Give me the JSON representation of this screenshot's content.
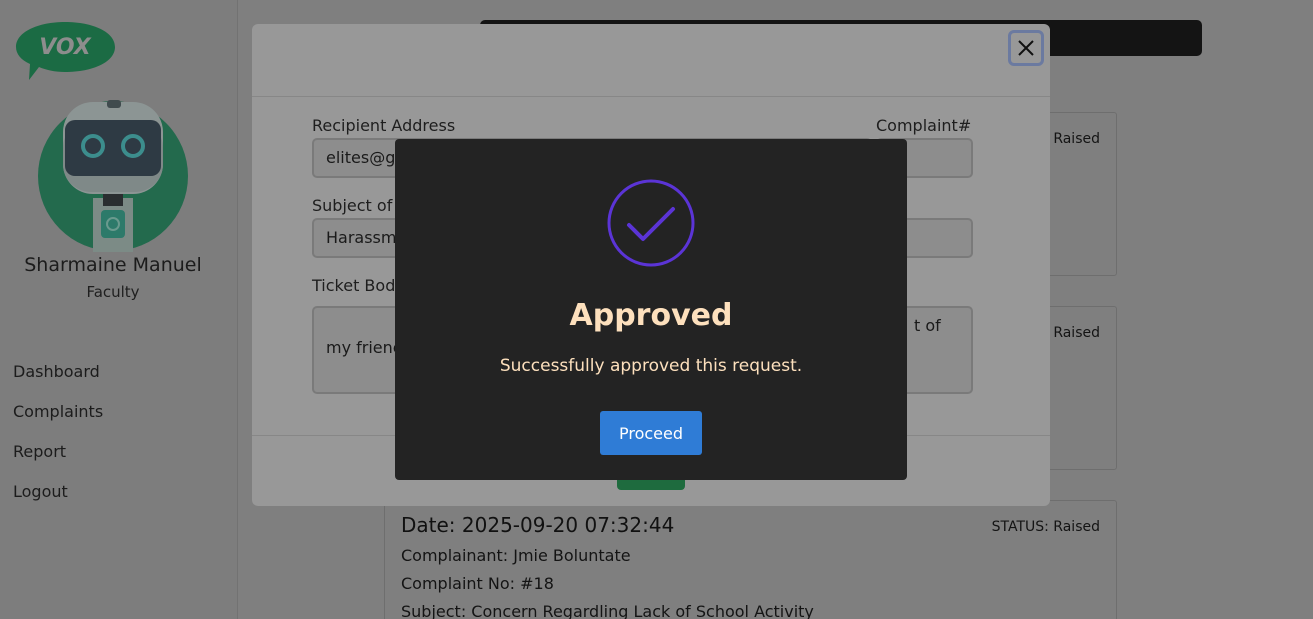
{
  "sidebar": {
    "logo_text": "VOX",
    "user_name": "Sharmaine Manuel",
    "user_role": "Faculty",
    "nav": [
      "Dashboard",
      "Complaints",
      "Report",
      "Logout"
    ]
  },
  "cards": [
    {
      "status": "Raised"
    },
    {
      "status": "Raised"
    },
    {
      "status": "STATUS: Raised",
      "date": "Date: 2025-09-20 07:32:44",
      "complainant": "Complainant: Jmie Boluntate",
      "complaint_no": "Complaint No: #18",
      "subject": "Subject: Concern Regardling Lack of School Activity"
    }
  ],
  "modal": {
    "recipient_label": "Recipient Address",
    "recipient_value": "elites@g",
    "complaint_label": "Complaint#",
    "subject_label": "Subject of",
    "subject_value": "Harassm",
    "body_label": "Ticket Body",
    "body_value": "my frienc",
    "body_tail": "t of"
  },
  "alert": {
    "title": "Approved",
    "message": "Successfully approved this request.",
    "button": "Proceed",
    "accent": "#5b34d6",
    "button_color": "#2f7cd6"
  }
}
